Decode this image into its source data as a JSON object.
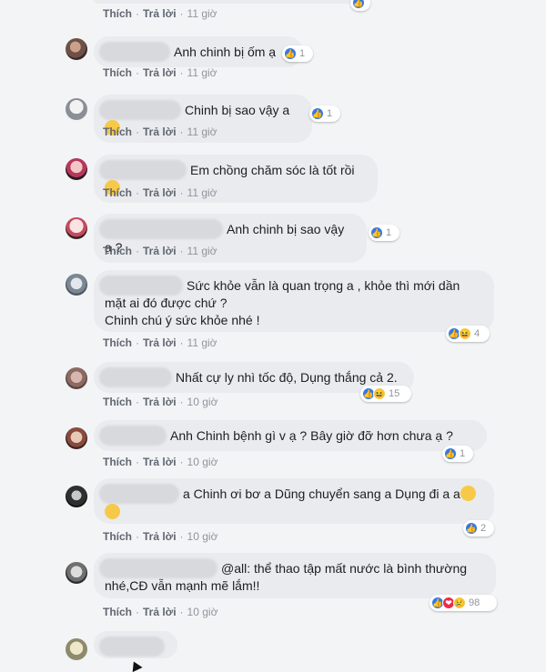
{
  "actions": {
    "like": "Thích",
    "reply": "Trả lời",
    "sep": "·"
  },
  "comments": [
    {
      "text": "",
      "time": "11 giờ"
    },
    {
      "text": "Anh chinh bị ốm ạ",
      "time": "11 giờ",
      "reactions": {
        "count": "1",
        "icons": [
          "like"
        ]
      }
    },
    {
      "text": "Chinh bị sao vậy a",
      "time": "11 giờ",
      "reactions": {
        "count": "1",
        "icons": [
          "like"
        ]
      }
    },
    {
      "text": "Em chồng chăm sóc là tốt rồi",
      "time": "11 giờ"
    },
    {
      "text": "Anh chinh bị sao vậy ạ ?",
      "time": "11 giờ",
      "reactions": {
        "count": "1",
        "icons": [
          "like"
        ]
      }
    },
    {
      "text_line1": "Sức khỏe vẫn là quan trọng a , khỏe thì mới dần",
      "text_line2": "mặt ai đó được chứ ?",
      "text_line3": "Chinh chú ý sức khỏe nhé !",
      "time": "11 giờ",
      "reactions": {
        "count": "4",
        "icons": [
          "like",
          "haha"
        ]
      }
    },
    {
      "text": "Nhất cự ly nhì tốc độ, Dụng thắng cả 2.",
      "time": "10 giờ",
      "reactions": {
        "count": "15",
        "icons": [
          "like",
          "haha"
        ]
      }
    },
    {
      "text": "Anh Chinh bệnh gì v ạ ? Bây giờ đỡ hơn chưa ạ ?",
      "time": "10 giờ",
      "reactions": {
        "count": "1",
        "icons": [
          "like"
        ]
      }
    },
    {
      "text": "a Chinh ơi bơ a Dũng chuyển sang a Dụng đi a a",
      "time": "10 giờ",
      "reactions": {
        "count": "2",
        "icons": [
          "like"
        ]
      }
    },
    {
      "text_line1": "@all: thể thao tập mất nước là bình thường",
      "text_line2": "nhé,CĐ vẫn mạnh mẽ lắm!!",
      "time": "10 giờ",
      "reactions": {
        "count": "98",
        "icons": [
          "like",
          "love",
          "haha"
        ]
      }
    }
  ],
  "colors": {
    "like": "#3578e5",
    "haha": "#f7c948",
    "love": "#f0284a"
  }
}
